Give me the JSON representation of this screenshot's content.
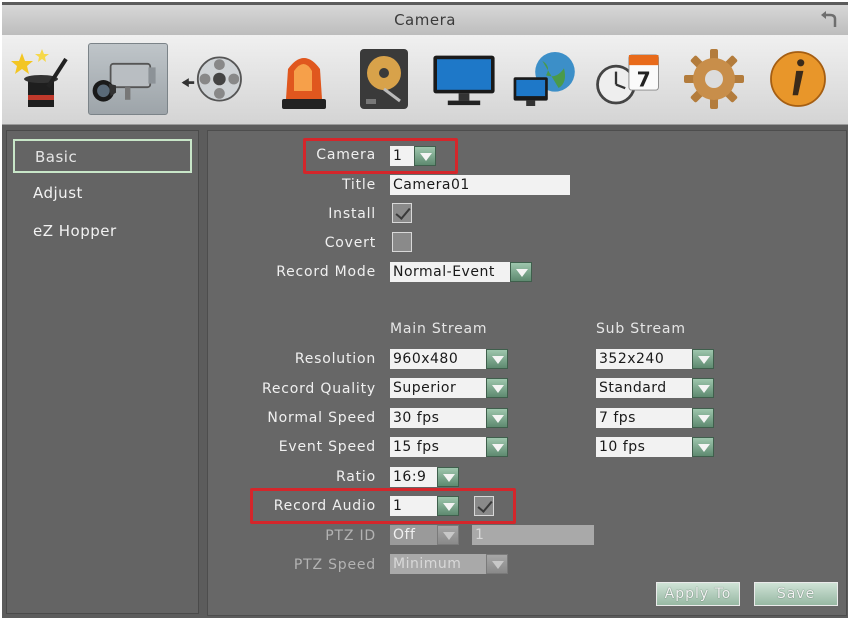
{
  "window": {
    "title": "Camera"
  },
  "toolbar": {
    "icons": [
      {
        "name": "wizard-icon"
      },
      {
        "name": "camera-icon",
        "selected": true
      },
      {
        "name": "record-reel-icon"
      },
      {
        "name": "alarm-light-icon"
      },
      {
        "name": "hard-disk-icon"
      },
      {
        "name": "monitor-icon"
      },
      {
        "name": "network-globe-icon"
      },
      {
        "name": "schedule-icon"
      },
      {
        "name": "settings-gear-icon"
      },
      {
        "name": "info-icon"
      }
    ],
    "schedule_day": "7"
  },
  "sidebar": {
    "items": [
      {
        "label": "Basic",
        "active": true
      },
      {
        "label": "Adjust"
      },
      {
        "label": "eZ Hopper"
      }
    ]
  },
  "form": {
    "camera": {
      "label": "Camera",
      "value": "1"
    },
    "title": {
      "label": "Title",
      "value": "Camera01"
    },
    "install": {
      "label": "Install",
      "checked": true
    },
    "covert": {
      "label": "Covert",
      "checked": false
    },
    "record_mode": {
      "label": "Record Mode",
      "value": "Normal-Event"
    },
    "columns": {
      "main": "Main Stream",
      "sub": "Sub Stream"
    },
    "resolution": {
      "label": "Resolution",
      "main": "960x480",
      "sub": "352x240"
    },
    "record_quality": {
      "label": "Record Quality",
      "main": "Superior",
      "sub": "Standard"
    },
    "normal_speed": {
      "label": "Normal Speed",
      "main": "30 fps",
      "sub": "7 fps"
    },
    "event_speed": {
      "label": "Event Speed",
      "main": "15 fps",
      "sub": "10 fps"
    },
    "ratio": {
      "label": "Ratio",
      "value": "16:9"
    },
    "record_audio": {
      "label": "Record Audio",
      "value": "1",
      "checked": true
    },
    "ptz_id": {
      "label": "PTZ ID",
      "value": "Off",
      "address": "1"
    },
    "ptz_speed": {
      "label": "PTZ Speed",
      "value": "Minimum"
    }
  },
  "buttons": {
    "apply_to": "Apply To",
    "save": "Save"
  },
  "colors": {
    "highlight": "#d4262b",
    "panel": "#676767",
    "accent": "#7fae91"
  }
}
